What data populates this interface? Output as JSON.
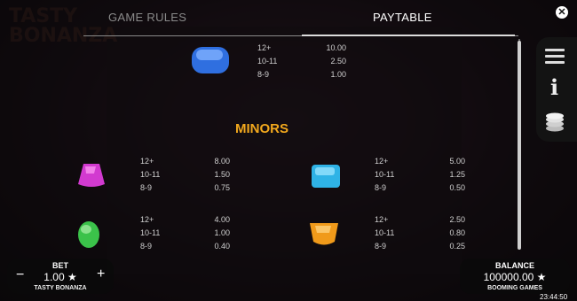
{
  "tabs": {
    "game_rules": "GAME RULES",
    "paytable": "PAYTABLE"
  },
  "close_icon": "close-icon",
  "side_menu": {
    "menu_icon": "hamburger-menu-icon",
    "info_icon": "info-icon",
    "bet_icon": "coin-stack-icon",
    "info_glyph": "i"
  },
  "top_symbol": {
    "color": "#2f6fe0",
    "payouts": [
      {
        "count": "12+",
        "value": "10.00"
      },
      {
        "count": "10-11",
        "value": "2.50"
      },
      {
        "count": "8-9",
        "value": "1.00"
      }
    ]
  },
  "minors_title": "MINORS",
  "minors": [
    {
      "name": "pink",
      "color": "#d23ad0",
      "payouts": [
        {
          "count": "12+",
          "value": "8.00"
        },
        {
          "count": "10-11",
          "value": "1.50"
        },
        {
          "count": "8-9",
          "value": "0.75"
        }
      ]
    },
    {
      "name": "cyan",
      "color": "#2fb3e6",
      "payouts": [
        {
          "count": "12+",
          "value": "5.00"
        },
        {
          "count": "10-11",
          "value": "1.25"
        },
        {
          "count": "8-9",
          "value": "0.50"
        }
      ]
    },
    {
      "name": "green",
      "color": "#3bc24a",
      "payouts": [
        {
          "count": "12+",
          "value": "4.00"
        },
        {
          "count": "10-11",
          "value": "1.00"
        },
        {
          "count": "8-9",
          "value": "0.40"
        }
      ]
    },
    {
      "name": "orange",
      "color": "#f09a1a",
      "payouts": [
        {
          "count": "12+",
          "value": "2.50"
        },
        {
          "count": "10-11",
          "value": "0.80"
        },
        {
          "count": "8-9",
          "value": "0.25"
        }
      ]
    }
  ],
  "bet": {
    "label": "BET",
    "value": "1.00 ★",
    "game": "TASTY BONANZA",
    "minus": "−",
    "plus": "+"
  },
  "balance": {
    "label": "BALANCE",
    "value": "100000.00 ★",
    "brand": "BOOMING GAMES"
  },
  "clock": "23:44:50"
}
